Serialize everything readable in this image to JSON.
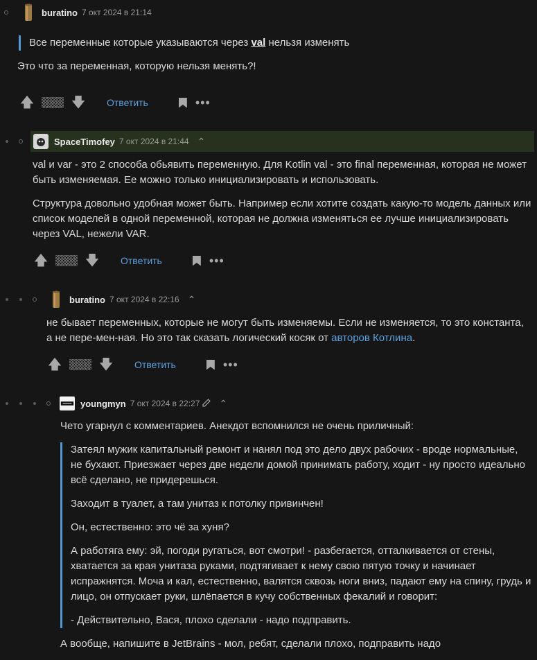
{
  "comments": [
    {
      "user": "buratino",
      "time": "7 окт 2024 в 21:14",
      "quote_pre": "Все переменные которые указываются через ",
      "quote_kw": "val",
      "quote_post": " нельзя изменять",
      "text": "Это что за переменная, которую нельзя менять?!",
      "reply": "Ответить"
    },
    {
      "user": "SpaceTimofey",
      "time": "7 окт 2024 в 21:44",
      "p1": "val и var - это 2 способа обьявить переменную. Для Kotlin val - это final переменная, которая не может быть изменяемая. Ее можно только инициализировать и использовать.",
      "p2": "Структура довольно удобная может быть. Например если хотите создать какую-то модель данных или список моделей в одной переменной, которая не должна изменяться ее лучше инициализировать через VAL, нежели VAR.",
      "reply": "Ответить"
    },
    {
      "user": "buratino",
      "time": "7 окт 2024 в 22:16",
      "text_pre": "не бывает переменных, которые не могут быть изменяемы. Если не изменяется, то это константа, а не пере-мен-ная. Но это так сказать логический косяк от ",
      "link": "авторов Котлина",
      "text_post": ".",
      "reply": "Ответить"
    },
    {
      "user": "youngmyn",
      "time": "7 окт 2024 в 22:27",
      "intro": "Чето угарнул с комментариев. Анекдот вспомнился не очень приличный:",
      "q1": "Затеял мужик капитальный ремонт и нанял под это дело двух рабочих - вроде нормальные, не бухают. Приезжает через две недели домой принимать работу, ходит - ну просто идеально всё сделано, не придерешься.",
      "q2": "Заходит в туалет, а там унитаз к потолку привинчен!",
      "q3": "Он, естественно: это чё за хуня?",
      "q4": "А работяга ему: эй, погоди ругаться, вот смотри! - разбегается, отталкивается от стены, хватается за края унитаза руками, подтягивает к нему свою пятую точку и начинает испражнятся. Моча и кал, естественно, валятся сквозь ноги вниз, падают ему на спину, грудь и лицо, он отпускает руки, шлёпается в кучу собственных фекалий и говорит:",
      "q5": "- Действительно, Вася, плохо сделали - надо подправить.",
      "outro": "А вообще, напишите в JetBrains - мол, ребят, сделали плохо, подправить надо"
    }
  ],
  "colors": {
    "link": "#5aa2e0",
    "highlight": "#26321d",
    "quote_bar": "#4e9ad6"
  }
}
